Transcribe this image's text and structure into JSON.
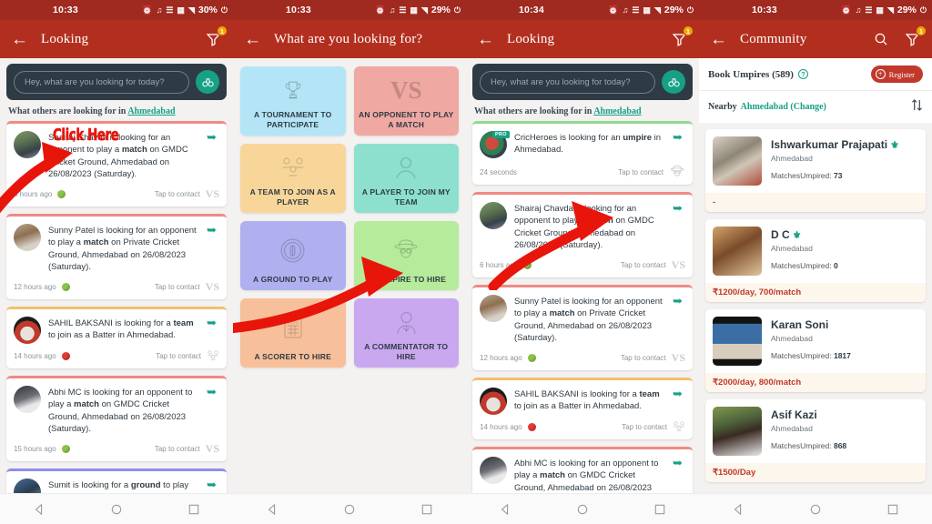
{
  "panels": [
    {
      "statusbar": {
        "time": "10:33",
        "battery": "30%"
      },
      "appbar": {
        "title": "Looking",
        "filter_badge": "1"
      },
      "search": {
        "placeholder": "Hey, what are you looking for today?"
      },
      "subhead": {
        "prefix": "What others are looking for in ",
        "location": "Ahmedabad"
      },
      "overlay": {
        "click_here": "Click Here"
      },
      "cards": [
        {
          "text_before": "Shairaj Chavda is looking for an opponent to play a ",
          "bold": "match",
          "text_after": " on GMDC Cricket Ground, Ahmedabad on 26/08/2023 (Saturday).",
          "ago": "6 hours ago",
          "ball": "green",
          "tap": "Tap to contact",
          "type": "match"
        },
        {
          "text_before": "Sunny Patel is looking for an opponent to play a ",
          "bold": "match",
          "text_after": " on Private Cricket Ground, Ahmedabad on 26/08/2023 (Saturday).",
          "ago": "12 hours ago",
          "ball": "green",
          "tap": "Tap to contact",
          "type": "match"
        },
        {
          "text_before": "SAHIL BAKSANI is looking for a ",
          "bold": "team",
          "text_after": " to join as a Batter in Ahmedabad.",
          "ago": "14 hours ago",
          "ball": "red",
          "tap": "Tap to contact",
          "type": "team"
        },
        {
          "text_before": "Abhi MC is looking for an opponent to play a ",
          "bold": "match",
          "text_after": " on GMDC Cricket Ground, Ahmedabad on 26/08/2023 (Saturday).",
          "ago": "15 hours ago",
          "ball": "green",
          "tap": "Tap to contact",
          "type": "match"
        },
        {
          "text_before": "Sumit is looking for a ",
          "bold": "ground",
          "text_after": " to play",
          "ago": "",
          "ball": "green",
          "tap": "",
          "type": "ground"
        }
      ]
    },
    {
      "statusbar": {
        "time": "10:33",
        "battery": "29%"
      },
      "appbar": {
        "title": "What are you looking for?"
      },
      "options": [
        {
          "label": "A TOURNAMENT TO PARTICIPATE",
          "color": "#b3e5f7",
          "icon": "trophy-icon"
        },
        {
          "label": "AN OPPONENT TO PLAY A MATCH",
          "color": "#f0a8a2",
          "icon": "vs-icon"
        },
        {
          "label": "A TEAM TO JOIN AS A PLAYER",
          "color": "#f8d69a",
          "icon": "team-icon"
        },
        {
          "label": "A PLAYER TO JOIN MY TEAM",
          "color": "#8ce0cd",
          "icon": "player-icon"
        },
        {
          "label": "A GROUND TO PLAY",
          "color": "#b0b0f0",
          "icon": "ground-icon"
        },
        {
          "label": "AN UMPIRE TO HIRE",
          "color": "#b5eb9a",
          "icon": "umpire-icon"
        },
        {
          "label": "A SCORER TO HIRE",
          "color": "#f7c09a",
          "icon": "scorer-icon"
        },
        {
          "label": "A COMMENTATOR TO HIRE",
          "color": "#c9a8f0",
          "icon": "commentator-icon"
        }
      ]
    },
    {
      "statusbar": {
        "time": "10:34",
        "battery": "29%"
      },
      "appbar": {
        "title": "Looking",
        "filter_badge": "1"
      },
      "search": {
        "placeholder": "Hey, what are you looking for today?"
      },
      "subhead": {
        "prefix": "What others are looking for in ",
        "location": "Ahmedabad"
      },
      "cards": [
        {
          "text_before": "CricHeroes is looking for an ",
          "bold": "umpire",
          "text_after": " in Ahmedabad.",
          "ago": "24 seconds",
          "ball": "none",
          "tap": "Tap to contact",
          "type": "umpire",
          "badge": "PRO"
        },
        {
          "text_before": "Shairaj Chavda is looking for an opponent to play a ",
          "bold": "match",
          "text_after": " on GMDC Cricket Ground, Ahmedabad on 26/08/2023 (Saturday).",
          "ago": "6 hours ago",
          "ball": "green",
          "tap": "Tap to contact",
          "type": "match"
        },
        {
          "text_before": "Sunny Patel is looking for an opponent to play a ",
          "bold": "match",
          "text_after": " on Private Cricket Ground, Ahmedabad on 26/08/2023 (Saturday).",
          "ago": "12 hours ago",
          "ball": "green",
          "tap": "Tap to contact",
          "type": "match"
        },
        {
          "text_before": "SAHIL BAKSANI is looking for a ",
          "bold": "team",
          "text_after": " to join as a Batter in Ahmedabad.",
          "ago": "14 hours ago",
          "ball": "red",
          "tap": "Tap to contact",
          "type": "team"
        },
        {
          "text_before": "Abhi MC is looking for an opponent to play a ",
          "bold": "match",
          "text_after": " on GMDC Cricket Ground, Ahmedabad on 26/08/2023",
          "ago": "",
          "ball": "green",
          "tap": "",
          "type": "match"
        }
      ]
    },
    {
      "statusbar": {
        "time": "10:33",
        "battery": "29%"
      },
      "appbar": {
        "title": "Community",
        "filter_badge": "1"
      },
      "section": {
        "title": "Book Umpires (589)",
        "register": "Register"
      },
      "nearby": {
        "label": "Nearby",
        "city": "Ahmedabad (Change)"
      },
      "umpires": [
        {
          "name": "Ishwarkumar Prajapati",
          "city": "Ahmedabad",
          "matches_label": "MatchesUmpired: ",
          "matches": "73",
          "fee": "-"
        },
        {
          "name": "D C",
          "city": "Ahmedabad",
          "matches_label": "MatchesUmpired: ",
          "matches": "0",
          "fee": "₹1200/day, 700/match"
        },
        {
          "name": "Karan Soni",
          "city": "Ahmedabad",
          "matches_label": "MatchesUmpired: ",
          "matches": "1817",
          "fee": "₹2000/day, 800/match"
        },
        {
          "name": "Asif Kazi",
          "city": "Ahmedabad",
          "matches_label": "MatchesUmpired: ",
          "matches": "868",
          "fee": "₹1500/Day"
        }
      ]
    }
  ],
  "colors": {
    "appbar": "#b22f1f",
    "statusbar": "#a02a20",
    "accent_green": "#16a085",
    "badge_orange": "#f0a500",
    "arrow_red": "#e8150b",
    "fee_red": "#c0392b"
  },
  "navbar": {
    "back": "back-triangle",
    "home": "home-circle",
    "recents": "recents-square"
  }
}
